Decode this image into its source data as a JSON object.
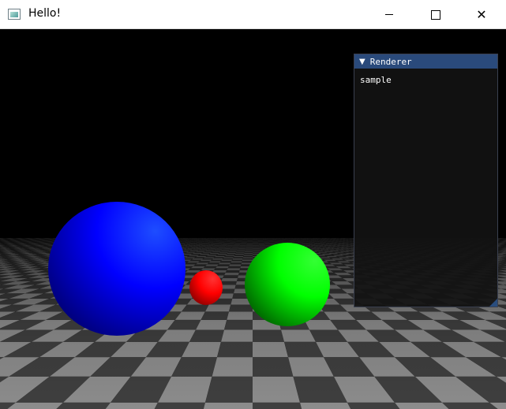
{
  "window": {
    "title": "Hello!",
    "controls": {
      "minimize": "minimize",
      "maximize": "maximize",
      "close": "close"
    }
  },
  "panel": {
    "title": "Renderer",
    "content": "sample"
  },
  "colors": {
    "titlebar_bg": "#ffffff",
    "panel_header": "#2a4a7b",
    "panel_bg": "#121212",
    "checker_light": "#8c8c8c",
    "checker_dark": "#3f3f3f",
    "sphere_blue": "#0000ff",
    "sphere_red": "#ff0000",
    "sphere_green": "#00ff00"
  }
}
